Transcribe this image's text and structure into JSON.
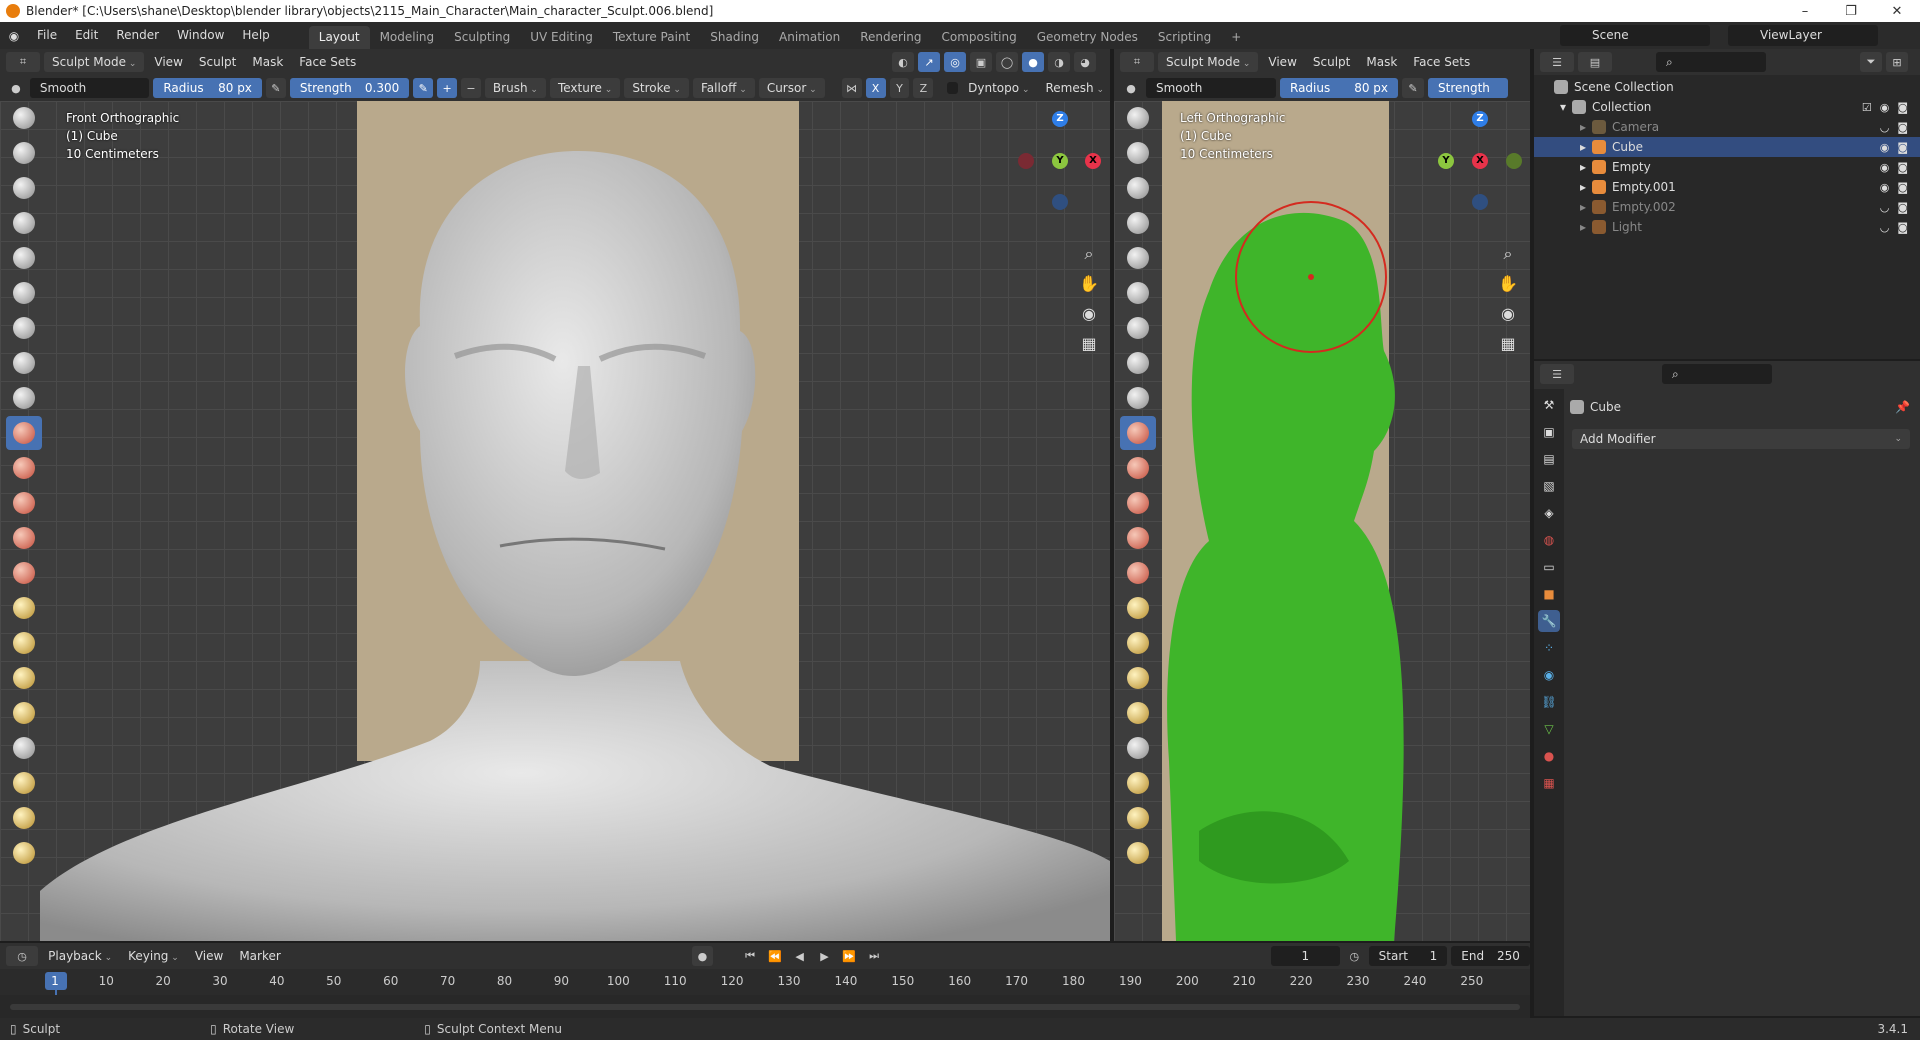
{
  "window": {
    "title": "Blender* [C:\\Users\\shane\\Desktop\\blender library\\objects\\2115_Main_Character\\Main_character_Sculpt.006.blend]",
    "controls": [
      "–",
      "❐",
      "✕"
    ]
  },
  "menu": [
    "File",
    "Edit",
    "Render",
    "Window",
    "Help"
  ],
  "workspaces": [
    {
      "label": "Layout",
      "active": true
    },
    {
      "label": "Modeling"
    },
    {
      "label": "Sculpting"
    },
    {
      "label": "UV Editing"
    },
    {
      "label": "Texture Paint"
    },
    {
      "label": "Shading"
    },
    {
      "label": "Animation"
    },
    {
      "label": "Rendering"
    },
    {
      "label": "Compositing"
    },
    {
      "label": "Geometry Nodes"
    },
    {
      "label": "Scripting"
    }
  ],
  "scene": {
    "name": "Scene",
    "view_layer": "ViewLayer"
  },
  "viewport_left": {
    "mode": "Sculpt Mode",
    "menus": [
      "View",
      "Sculpt",
      "Mask",
      "Face Sets"
    ],
    "brush_name": "Smooth",
    "radius_label": "Radius",
    "radius_value": "80 px",
    "strength_label": "Strength",
    "strength_value": "0.300",
    "brush_menus": [
      "Brush",
      "Texture",
      "Stroke",
      "Falloff",
      "Cursor"
    ],
    "axes": [
      "X",
      "Y",
      "Z"
    ],
    "dyntopo": "Dyntopo",
    "remesh": "Remesh",
    "info": [
      "Front Orthographic",
      "(1) Cube",
      "10 Centimeters"
    ]
  },
  "viewport_right": {
    "mode": "Sculpt Mode",
    "menus": [
      "View",
      "Sculpt",
      "Mask",
      "Face Sets"
    ],
    "brush_name": "Smooth",
    "radius_label": "Radius",
    "radius_value": "80 px",
    "strength_label": "Strength",
    "info": [
      "Left Orthographic",
      "(1) Cube",
      "10 Centimeters"
    ]
  },
  "gizmo": {
    "z": "Z",
    "y": "Y",
    "x": "X"
  },
  "colors": {
    "accent": "#4772b3",
    "mesh_green": "#3fb52a",
    "selected_row": "#334d80",
    "brush_circle": "#d42a1f"
  },
  "outliner": {
    "rows": [
      {
        "label": "Scene Collection",
        "indent": 0,
        "icon": "scene-collection-icon"
      },
      {
        "label": "Collection",
        "indent": 1,
        "icon": "collection-icon"
      },
      {
        "label": "Camera",
        "indent": 2,
        "icon": "camera-icon",
        "dim": true
      },
      {
        "label": "Cube",
        "indent": 2,
        "icon": "mesh-icon",
        "selected": true
      },
      {
        "label": "Empty",
        "indent": 2,
        "icon": "empty-icon"
      },
      {
        "label": "Empty.001",
        "indent": 2,
        "icon": "empty-icon"
      },
      {
        "label": "Empty.002",
        "indent": 2,
        "icon": "empty-icon",
        "dim": true
      },
      {
        "label": "Light",
        "indent": 2,
        "icon": "light-icon",
        "dim": true
      }
    ]
  },
  "properties": {
    "object": "Cube",
    "add_modifier": "Add Modifier"
  },
  "timeline": {
    "menus": [
      "Playback",
      "Keying",
      "View",
      "Marker"
    ],
    "current_frame": "1",
    "start_label": "Start",
    "start": "1",
    "end_label": "End",
    "end": "250",
    "ticks": [
      "1",
      "10",
      "20",
      "30",
      "40",
      "50",
      "60",
      "70",
      "80",
      "90",
      "100",
      "110",
      "120",
      "130",
      "140",
      "150",
      "160",
      "170",
      "180",
      "190",
      "200",
      "210",
      "220",
      "230",
      "240",
      "250"
    ]
  },
  "status": {
    "left": "Sculpt",
    "middle": "Rotate View",
    "right": "Sculpt Context Menu",
    "version": "3.4.1"
  }
}
